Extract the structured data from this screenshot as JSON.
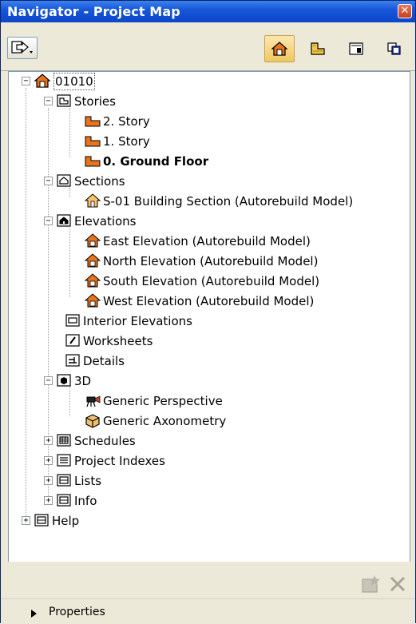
{
  "window": {
    "title": "Navigator - Project Map",
    "close_glyph": "✕"
  },
  "toolbar": {
    "left_button_icon": "export-arrow-icon",
    "right_buttons": [
      {
        "name": "project-map-icon"
      },
      {
        "name": "view-map-icon"
      },
      {
        "name": "layout-book-icon"
      },
      {
        "name": "publisher-sets-icon"
      }
    ]
  },
  "tree": {
    "root": "01010",
    "stories": {
      "label": "Stories",
      "items": [
        "2. Story",
        "1. Story",
        "0. Ground Floor"
      ]
    },
    "sections": {
      "label": "Sections",
      "items": [
        "S-01 Building Section (Autorebuild Model)"
      ]
    },
    "elevations": {
      "label": "Elevations",
      "items": [
        "East Elevation (Autorebuild Model)",
        "North Elevation (Autorebuild Model)",
        "South Elevation (Autorebuild Model)",
        "West Elevation (Autorebuild Model)"
      ]
    },
    "interior_elevations": "Interior Elevations",
    "worksheets": "Worksheets",
    "details": "Details",
    "three_d": {
      "label": "3D",
      "items": [
        "Generic Perspective",
        "Generic Axonometry"
      ]
    },
    "schedules": "Schedules",
    "project_indexes": "Project Indexes",
    "lists": "Lists",
    "info": "Info",
    "help": "Help"
  },
  "bottom": {
    "properties_label": "Properties"
  },
  "colors": {
    "title_bar": "#0b47c8",
    "selected_tab": "#f5d88a",
    "story_icon": "#e8731c"
  }
}
